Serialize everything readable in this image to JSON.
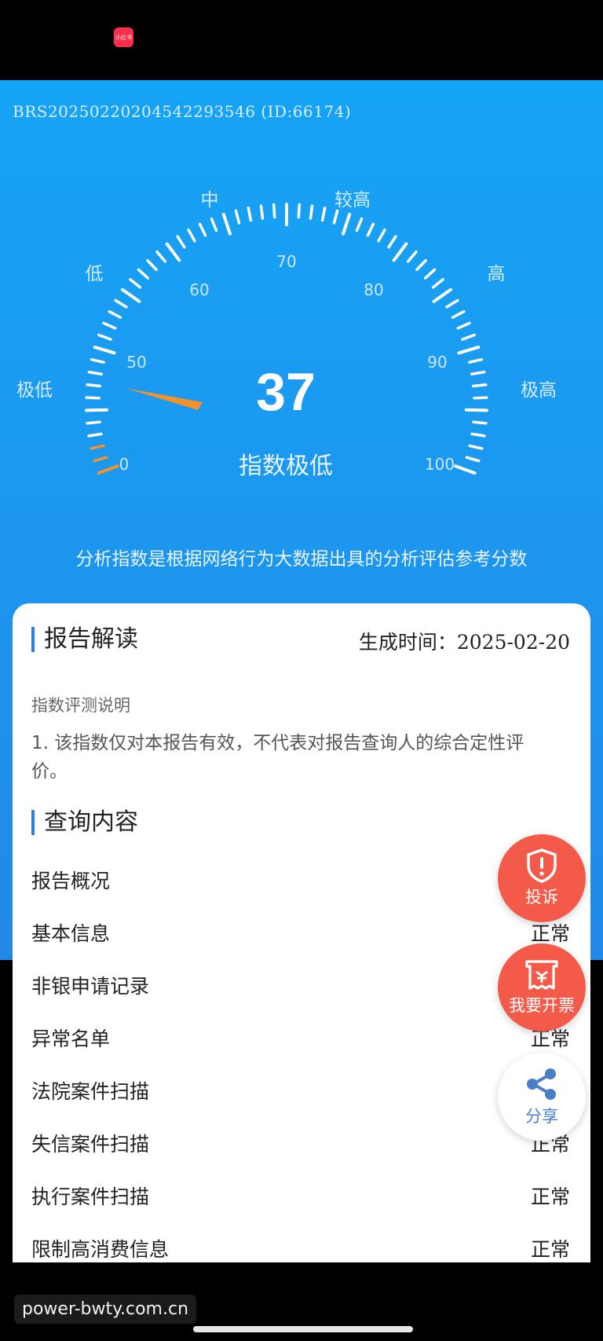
{
  "app": {
    "logo_text": "小红书"
  },
  "report": {
    "id_text": "BRS20250220204542293546 (ID:66174)",
    "score": "37",
    "level": "指数极低",
    "subtitle": "分析指数是根据网络行为大数据出具的分析评估参考分数"
  },
  "gauge": {
    "value": 37,
    "range_labels": [
      "极低",
      "低",
      "中",
      "较高",
      "高",
      "极高"
    ],
    "ticks": [
      "0",
      "50",
      "60",
      "70",
      "80",
      "90",
      "100"
    ],
    "colors": {
      "active": "#f3912c",
      "inactive": "#ffffff",
      "needle": "#f3912c"
    }
  },
  "interpretation": {
    "title": "报告解读",
    "gen_time_label": "生成时间：",
    "gen_date": "2025-02-20",
    "intro_title": "指数评测说明",
    "intro_text": "1. 该指数仅对本报告有效，不代表对报告查询人的综合定性评价。"
  },
  "query": {
    "title": "查询内容",
    "rows": [
      {
        "name": "报告概况",
        "status": ""
      },
      {
        "name": "基本信息",
        "status": "正常"
      },
      {
        "name": "非银申请记录",
        "status": ""
      },
      {
        "name": "异常名单",
        "status": "正常"
      },
      {
        "name": "法院案件扫描",
        "status": ""
      },
      {
        "name": "失信案件扫描",
        "status": "正常"
      },
      {
        "name": "执行案件扫描",
        "status": "正常"
      },
      {
        "name": "限制高消费信息",
        "status": "正常"
      }
    ]
  },
  "fabs": {
    "complaint": "投诉",
    "invoice": "我要开票",
    "share": "分享"
  },
  "watermark": "power-bwty.com.cn",
  "colors": {
    "accent": "#2f7fd8",
    "fab_red": "#f45a4a",
    "header_blue": "#1b98ef"
  }
}
